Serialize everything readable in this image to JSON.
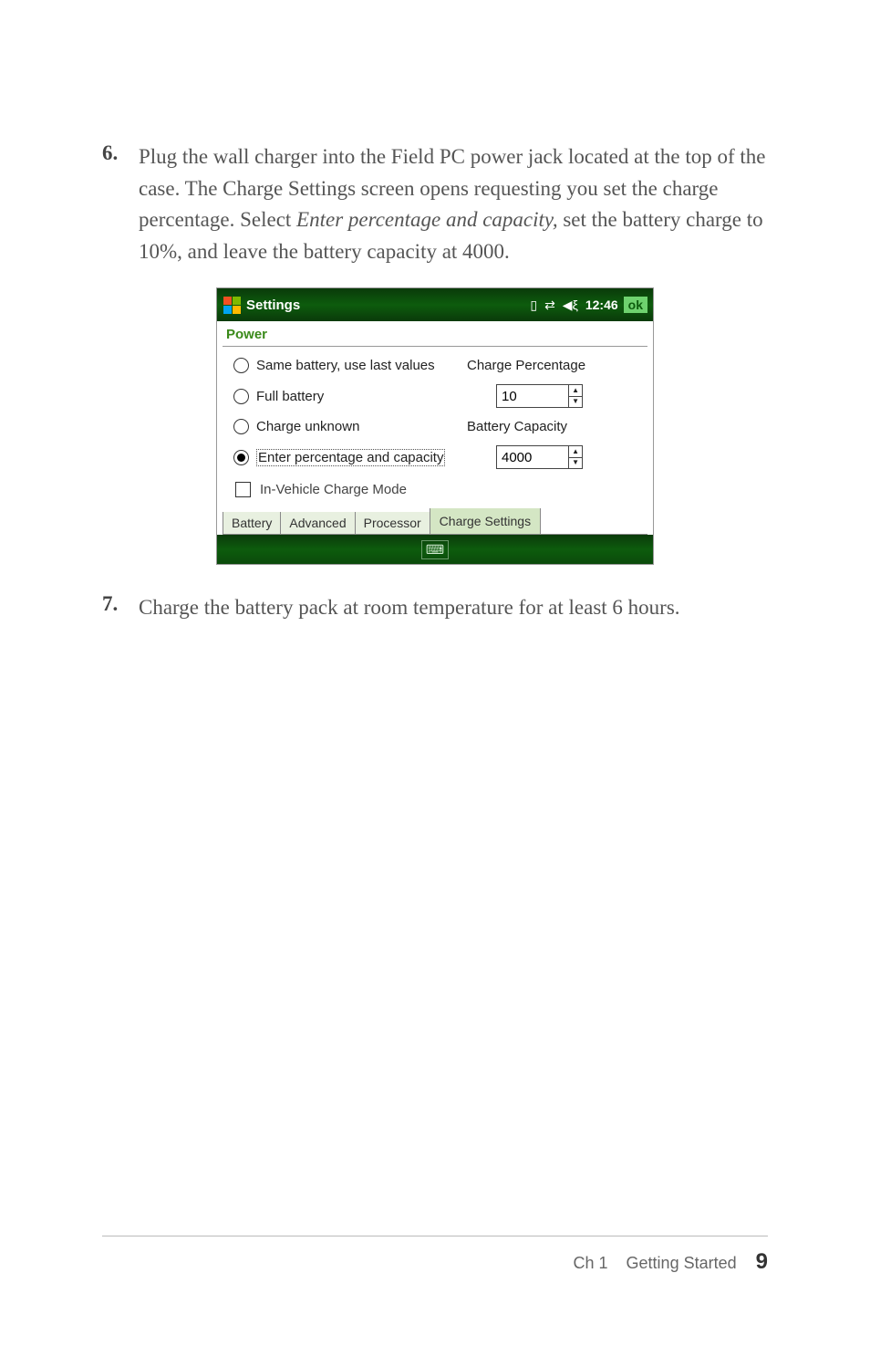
{
  "steps": {
    "s6": {
      "num": "6.",
      "text_before_em1": "Plug the wall charger into the Field PC power jack located at the top of the case. The Charge Settings screen opens requesting you set the charge percentage. Select ",
      "em1": "Enter percentage and capacity,",
      "text_after_em1": " set the battery charge to 10%, and leave the battery capacity at 4000."
    },
    "s7": {
      "num": "7.",
      "text": "Charge the battery pack at room temperature for at least 6 hours."
    }
  },
  "screenshot": {
    "titlebar": {
      "title": "Settings",
      "time": "12:46",
      "ok": "ok"
    },
    "panel_title": "Power",
    "radios": {
      "r1": "Same battery, use last values",
      "r2": "Full battery",
      "r3": "Charge unknown",
      "r4": "Enter percentage and capacity"
    },
    "labels": {
      "charge_pct": "Charge Percentage",
      "bat_cap": "Battery Capacity"
    },
    "values": {
      "pct": "10",
      "cap": "4000"
    },
    "checkbox": "In-Vehicle Charge Mode",
    "tabs": {
      "t1": "Battery",
      "t2": "Advanced",
      "t3": "Processor",
      "t4": "Charge Settings"
    }
  },
  "footer": {
    "chapter": "Ch 1",
    "section": "Getting Started",
    "page": "9"
  },
  "chart_data": null
}
